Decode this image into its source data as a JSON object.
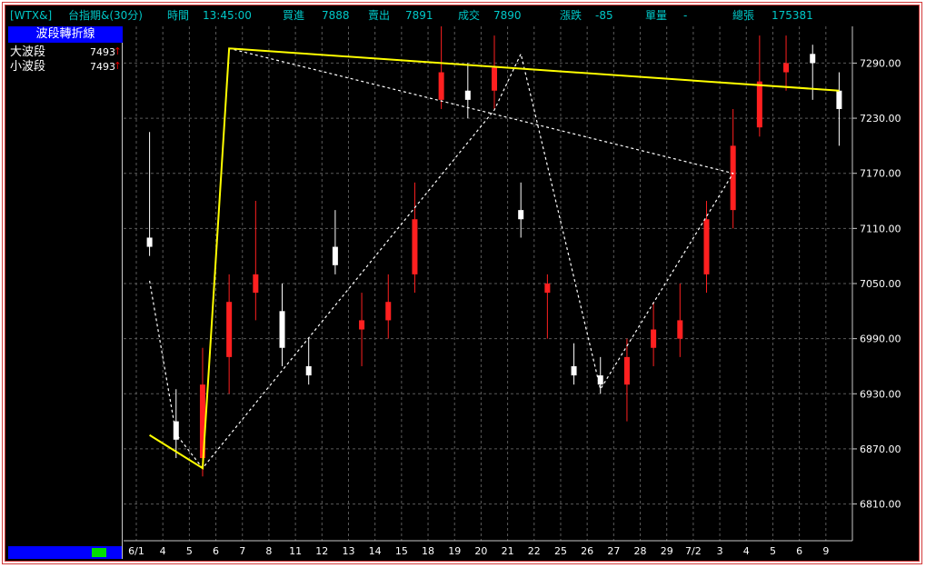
{
  "header": {
    "symbol": "[WTX&]",
    "instrument": "台指期&(30分)",
    "time_label": "時間",
    "time_value": "13:45:00",
    "bid_label": "買進",
    "bid_value": "7888",
    "ask_label": "賣出",
    "ask_value": "7891",
    "last_label": "成交",
    "last_value": "7890",
    "change_label": "漲跌",
    "change_value": "-85",
    "volume_label": "單量",
    "volume_value": "-",
    "total_label": "總張",
    "total_value": "175381"
  },
  "sidebar": {
    "title": "波段轉折線",
    "items": [
      {
        "label": "大波段",
        "value": "7493",
        "arrow": "↑"
      },
      {
        "label": "小波段",
        "value": "7493",
        "arrow": "↑"
      }
    ]
  },
  "colors": {
    "background": "#000000",
    "up_candle": "#ff2020",
    "down_candle": "#ffffff",
    "flat_candle": "#00d000",
    "major_wave": "#ffff00",
    "minor_wave": "#ffffff",
    "grid": "#5a5a5a",
    "header_text": "#00c8c8"
  },
  "chart_data": {
    "type": "candlestick",
    "ylim": [
      6770,
      7330
    ],
    "y_ticks": [
      "7290.00",
      "7230.00",
      "7170.00",
      "7110.00",
      "7050.00",
      "6990.00",
      "6930.00",
      "6870.00",
      "6810.00"
    ],
    "x_ticks": [
      "6/1",
      "4",
      "5",
      "6",
      "7",
      "8",
      "11",
      "12",
      "13",
      "14",
      "15",
      "18",
      "19",
      "20",
      "21",
      "22",
      "25",
      "26",
      "27",
      "28",
      "29",
      "7/2",
      "3",
      "4",
      "5",
      "6",
      "9"
    ],
    "grid": true,
    "major_wave_line": [
      {
        "x": "6/1",
        "y": 6885
      },
      {
        "x": "5",
        "y": 6849
      },
      {
        "x": "6",
        "y": 7306
      },
      {
        "x": "9",
        "y": 7260
      }
    ],
    "minor_wave_line": [
      {
        "x": "6/1",
        "y": 7053
      },
      {
        "x": "4",
        "y": 6886
      },
      {
        "x": "5",
        "y": 6849
      },
      {
        "x": "20",
        "y": 7239
      },
      {
        "x": "21",
        "y": 7300
      },
      {
        "x": "26",
        "y": 6935
      },
      {
        "x": "3",
        "y": 7170
      },
      {
        "x": "6",
        "y": 7306
      },
      {
        "x": "9",
        "y": 7260
      }
    ],
    "price_segments": [
      {
        "day": "6/1",
        "open": 7100,
        "close": 7090,
        "high": 7215,
        "low": 7080
      },
      {
        "day": "4",
        "open": 6900,
        "close": 6880,
        "high": 6935,
        "low": 6860
      },
      {
        "day": "5",
        "open": 6860,
        "close": 6940,
        "high": 6980,
        "low": 6840
      },
      {
        "day": "6",
        "open": 6970,
        "close": 7030,
        "high": 7060,
        "low": 6930
      },
      {
        "day": "7",
        "open": 7040,
        "close": 7060,
        "high": 7140,
        "low": 7010
      },
      {
        "day": "8",
        "open": 7020,
        "close": 6980,
        "high": 7050,
        "low": 6960
      },
      {
        "day": "11",
        "open": 6960,
        "close": 6950,
        "high": 6990,
        "low": 6940
      },
      {
        "day": "12",
        "open": 7090,
        "close": 7070,
        "high": 7130,
        "low": 7060
      },
      {
        "day": "13",
        "open": 7000,
        "close": 7010,
        "high": 7040,
        "low": 6960
      },
      {
        "day": "14",
        "open": 7010,
        "close": 7030,
        "high": 7060,
        "low": 6990
      },
      {
        "day": "15",
        "open": 7060,
        "close": 7120,
        "high": 7160,
        "low": 7040
      },
      {
        "day": "18",
        "open": 7250,
        "close": 7280,
        "high": 7330,
        "low": 7240
      },
      {
        "day": "19",
        "open": 7260,
        "close": 7250,
        "high": 7290,
        "low": 7230
      },
      {
        "day": "20",
        "open": 7260,
        "close": 7285,
        "high": 7320,
        "low": 7240
      },
      {
        "day": "21",
        "open": 7130,
        "close": 7120,
        "high": 7160,
        "low": 7100
      },
      {
        "day": "22",
        "open": 7040,
        "close": 7050,
        "high": 7060,
        "low": 6990
      },
      {
        "day": "25",
        "open": 6960,
        "close": 6950,
        "high": 6985,
        "low": 6940
      },
      {
        "day": "26",
        "open": 6950,
        "close": 6940,
        "high": 6970,
        "low": 6930
      },
      {
        "day": "27",
        "open": 6940,
        "close": 6970,
        "high": 6990,
        "low": 6900
      },
      {
        "day": "28",
        "open": 6980,
        "close": 7000,
        "high": 7030,
        "low": 6960
      },
      {
        "day": "29",
        "open": 6990,
        "close": 7010,
        "high": 7050,
        "low": 6970
      },
      {
        "day": "7/2",
        "open": 7060,
        "close": 7120,
        "high": 7140,
        "low": 7040
      },
      {
        "day": "3",
        "open": 7130,
        "close": 7200,
        "high": 7240,
        "low": 7110
      },
      {
        "day": "4",
        "open": 7220,
        "close": 7270,
        "high": 7320,
        "low": 7210
      },
      {
        "day": "5",
        "open": 7280,
        "close": 7290,
        "high": 7320,
        "low": 7260
      },
      {
        "day": "6",
        "open": 7300,
        "close": 7290,
        "high": 7310,
        "low": 7250
      },
      {
        "day": "9",
        "open": 7260,
        "close": 7240,
        "high": 7280,
        "low": 7200
      }
    ]
  }
}
